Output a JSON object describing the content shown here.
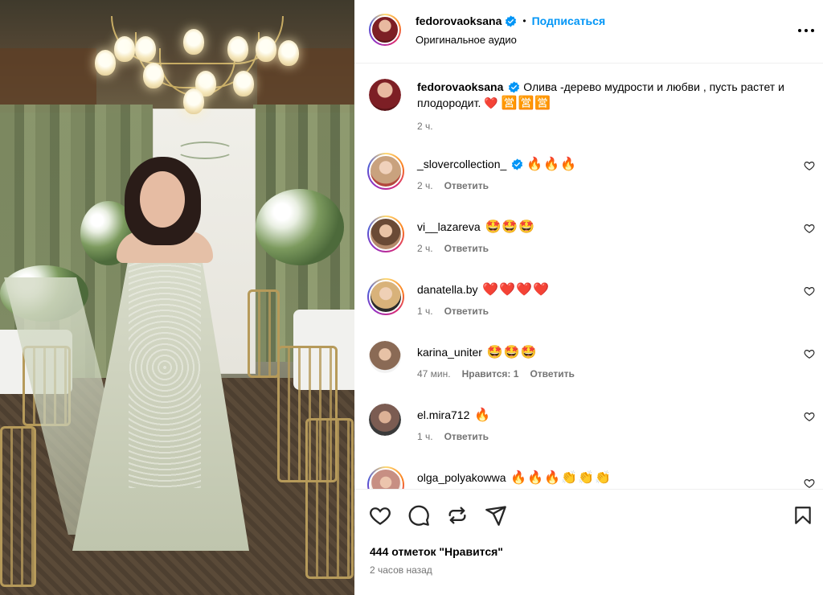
{
  "post": {
    "author": "fedorovaoksana",
    "follow_label": "Подписаться",
    "separator": "•",
    "audio_label": "Оригинальное аудио",
    "media_alt": "Фото"
  },
  "caption": {
    "username": "fedorovaoksana",
    "text": "Олива -дерево мудрости и любви , пусть растет и плодородит. ❤️",
    "text_extra": "🈺🈺🈺",
    "time": "2 ч."
  },
  "comments": [
    {
      "username": "_slovercollection_",
      "verified": true,
      "text": "🔥🔥🔥",
      "time": "2 ч.",
      "likes": "",
      "reply": "Ответить",
      "avatar_color": "#c9a27e"
    },
    {
      "username": "vi__lazareva",
      "verified": false,
      "text": "🤩🤩🤩",
      "time": "2 ч.",
      "likes": "",
      "reply": "Ответить",
      "avatar_color": "#b58b6c"
    },
    {
      "username": "danatella.by",
      "verified": false,
      "text": "❤️❤️❤️❤️",
      "time": "1 ч.",
      "likes": "",
      "reply": "Ответить",
      "avatar_color": "#d8b27a"
    },
    {
      "username": "karina_uniter",
      "verified": false,
      "text": "🤩🤩🤩",
      "time": "47 мин.",
      "likes": "Нравится: 1",
      "reply": "Ответить",
      "avatar_color": "#8a6a55"
    },
    {
      "username": "el.mira712",
      "verified": false,
      "text": "🔥",
      "time": "1 ч.",
      "likes": "",
      "reply": "Ответить",
      "avatar_color": "#7b5c52"
    },
    {
      "username": "olga_polyakowwa",
      "verified": false,
      "text": "🔥🔥🔥👏👏👏",
      "time": "",
      "likes": "",
      "reply": "",
      "avatar_color": "#c78f83"
    }
  ],
  "footer": {
    "likes_text": "444 отметок \"Нравится\"",
    "timestamp": "2 часов назад"
  },
  "colors": {
    "accent": "#0095f6",
    "muted": "#737373",
    "verified": "#0095f6",
    "divider": "#efefef"
  },
  "icons": [
    "heart-icon",
    "comment-icon",
    "repost-icon",
    "share-icon",
    "save-icon",
    "more-icon",
    "verified-icon"
  ]
}
